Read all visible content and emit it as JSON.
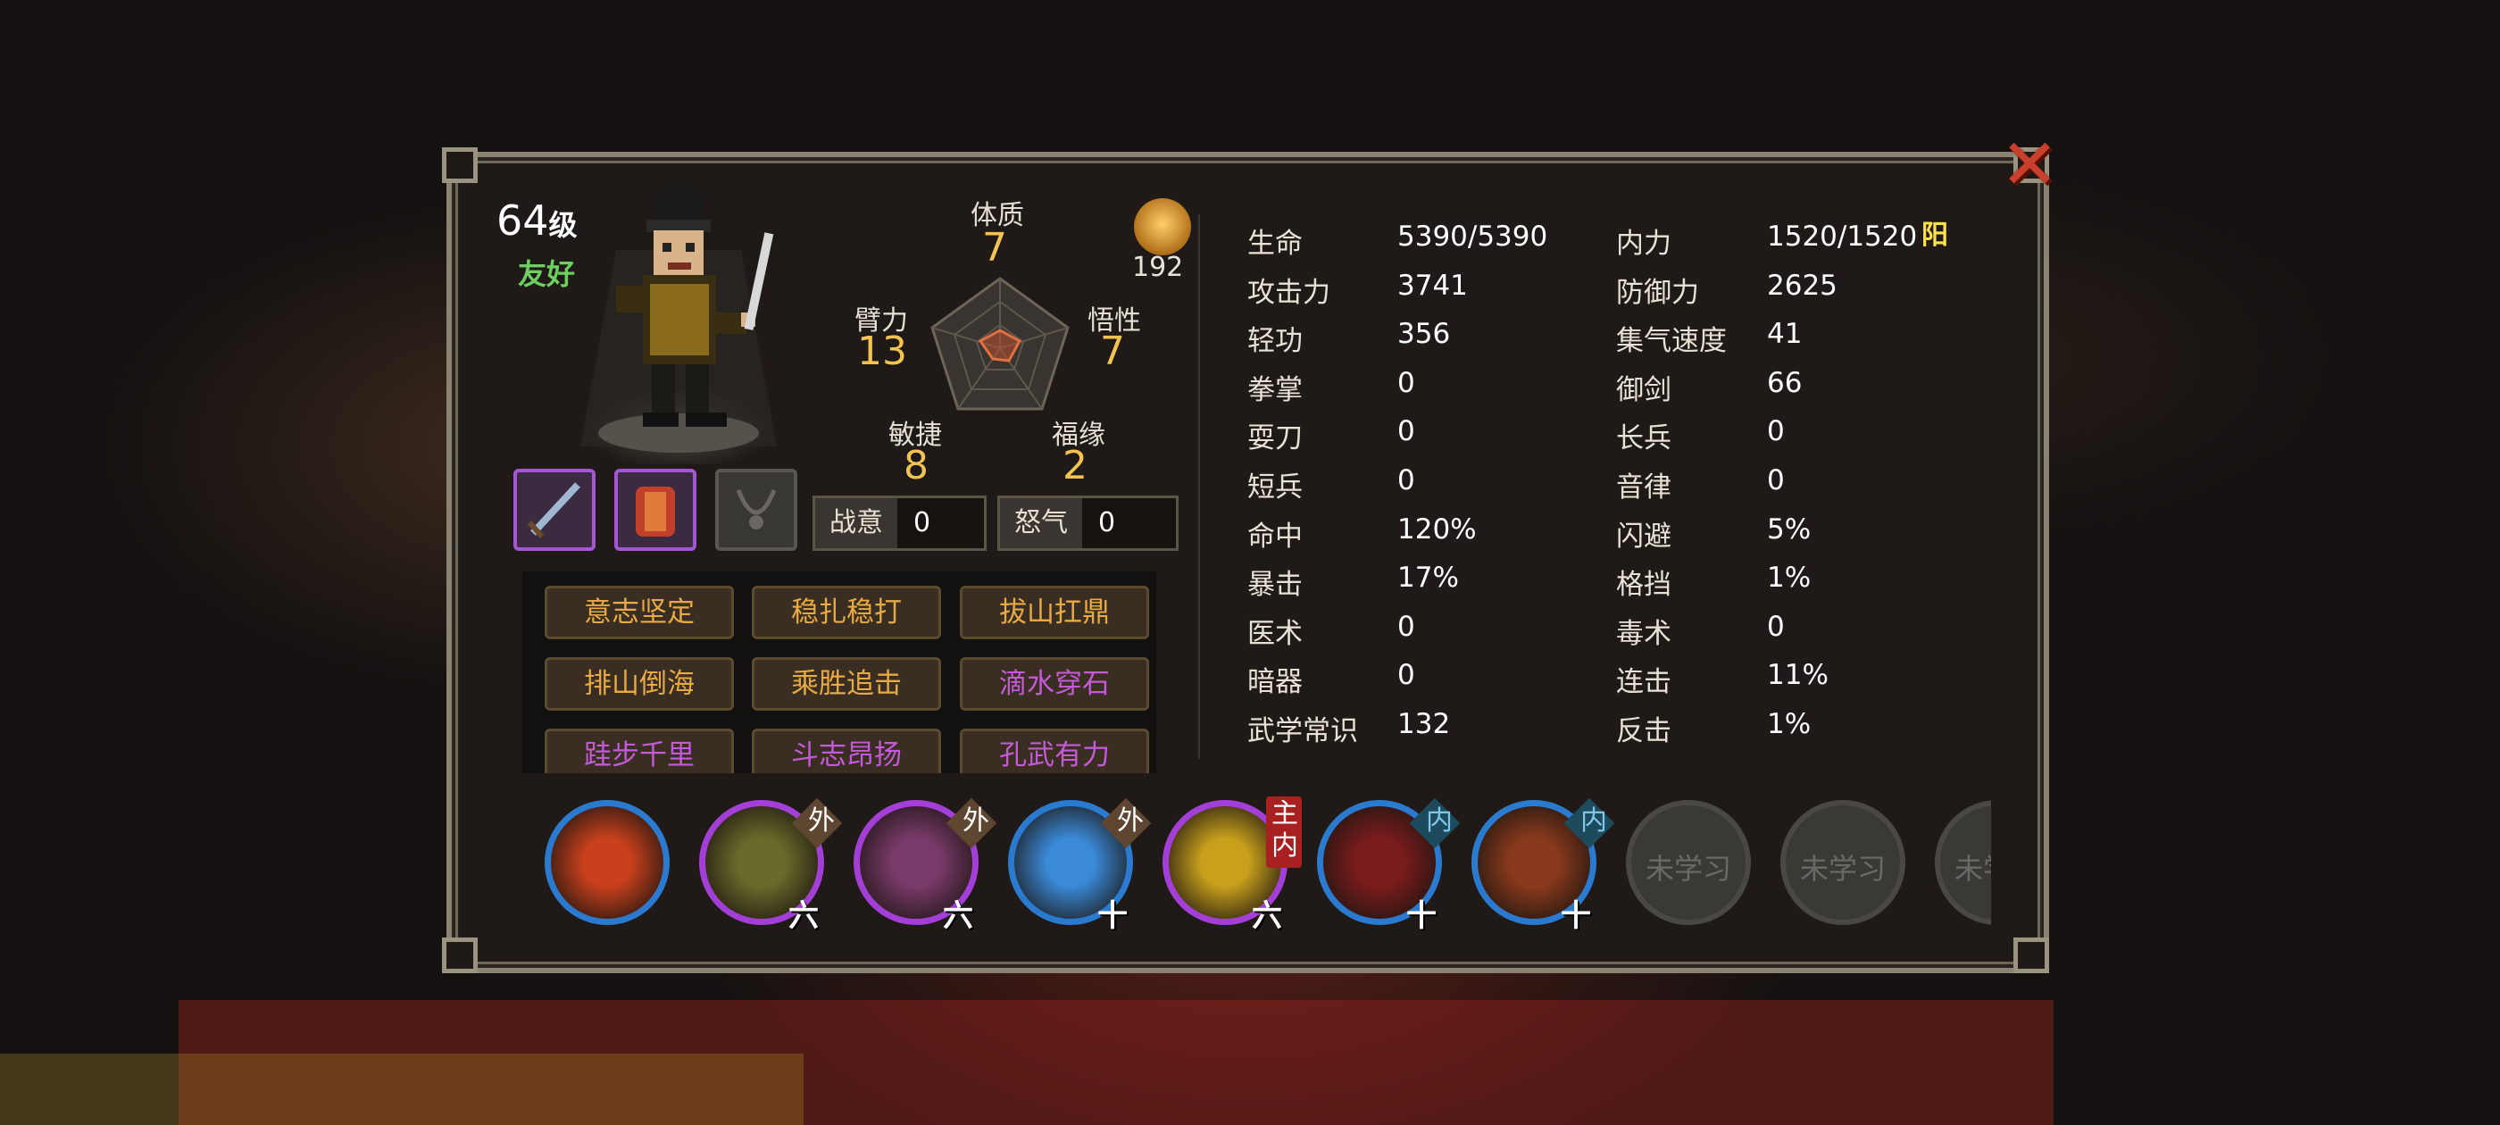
{
  "character": {
    "level": "64",
    "level_unit": "级",
    "attitude": "友好",
    "fame_value": "192"
  },
  "attributes": {
    "constitution": {
      "label": "体质",
      "value": "7"
    },
    "strength": {
      "label": "臂力",
      "value": "13"
    },
    "insight": {
      "label": "悟性",
      "value": "7"
    },
    "agility": {
      "label": "敏捷",
      "value": "8"
    },
    "fortune": {
      "label": "福缘",
      "value": "2"
    }
  },
  "meters": {
    "fighting_spirit": {
      "label": "战意",
      "value": "0"
    },
    "rage": {
      "label": "怒气",
      "value": "0"
    }
  },
  "traits": [
    {
      "label": "意志坚定",
      "color": "gold"
    },
    {
      "label": "稳扎稳打",
      "color": "gold"
    },
    {
      "label": "拔山扛鼎",
      "color": "gold"
    },
    {
      "label": "排山倒海",
      "color": "gold"
    },
    {
      "label": "乘胜追击",
      "color": "gold"
    },
    {
      "label": "滴水穿石",
      "color": "purple"
    },
    {
      "label": "跬步千里",
      "color": "purple"
    },
    {
      "label": "斗志昂扬",
      "color": "purple"
    },
    {
      "label": "孔武有力",
      "color": "purple"
    }
  ],
  "stats_left": [
    {
      "label": "生命",
      "value": "5390/5390"
    },
    {
      "label": "攻击力",
      "value": "3741"
    },
    {
      "label": "轻功",
      "value": "356"
    },
    {
      "label": "拳掌",
      "value": "0"
    },
    {
      "label": "耍刀",
      "value": "0"
    },
    {
      "label": "短兵",
      "value": "0"
    },
    {
      "label": "命中",
      "value": "120%"
    },
    {
      "label": "暴击",
      "value": "17%"
    },
    {
      "label": "医术",
      "value": "0"
    },
    {
      "label": "暗器",
      "value": "0"
    },
    {
      "label": "武学常识",
      "value": "132"
    }
  ],
  "stats_right": [
    {
      "label": "内力",
      "value": "1520/1520"
    },
    {
      "label": "防御力",
      "value": "2625"
    },
    {
      "label": "集气速度",
      "value": "41"
    },
    {
      "label": "御剑",
      "value": "66"
    },
    {
      "label": "长兵",
      "value": "0"
    },
    {
      "label": "音律",
      "value": "0"
    },
    {
      "label": "闪避",
      "value": "5%"
    },
    {
      "label": "格挡",
      "value": "1%"
    },
    {
      "label": "毒术",
      "value": "0"
    },
    {
      "label": "连击",
      "value": "11%"
    },
    {
      "label": "反击",
      "value": "1%"
    }
  ],
  "inner_tag": "阳",
  "skills": [
    {
      "tag": "",
      "mark": "",
      "ring": "#2a7bd0",
      "inner": "#c8401c"
    },
    {
      "tag": "外",
      "mark": "六",
      "ring": "#a33fd6",
      "inner": "#6a6a2a"
    },
    {
      "tag": "外",
      "mark": "六",
      "ring": "#a33fd6",
      "inner": "#7a3a6a"
    },
    {
      "tag": "外",
      "mark": "十",
      "ring": "#2a7bd0",
      "inner": "#3a8ad8"
    },
    {
      "tag": "主内",
      "mark": "六",
      "ring": "#a33fd6",
      "inner": "#c8a01c"
    },
    {
      "tag": "内",
      "mark": "十",
      "ring": "#2a7bd0",
      "inner": "#7a1c1c"
    },
    {
      "tag": "内",
      "mark": "十",
      "ring": "#2a7bd0",
      "inner": "#8a3a1c"
    }
  ],
  "locked_skills": [
    "未学习",
    "未学习",
    "未学习"
  ]
}
